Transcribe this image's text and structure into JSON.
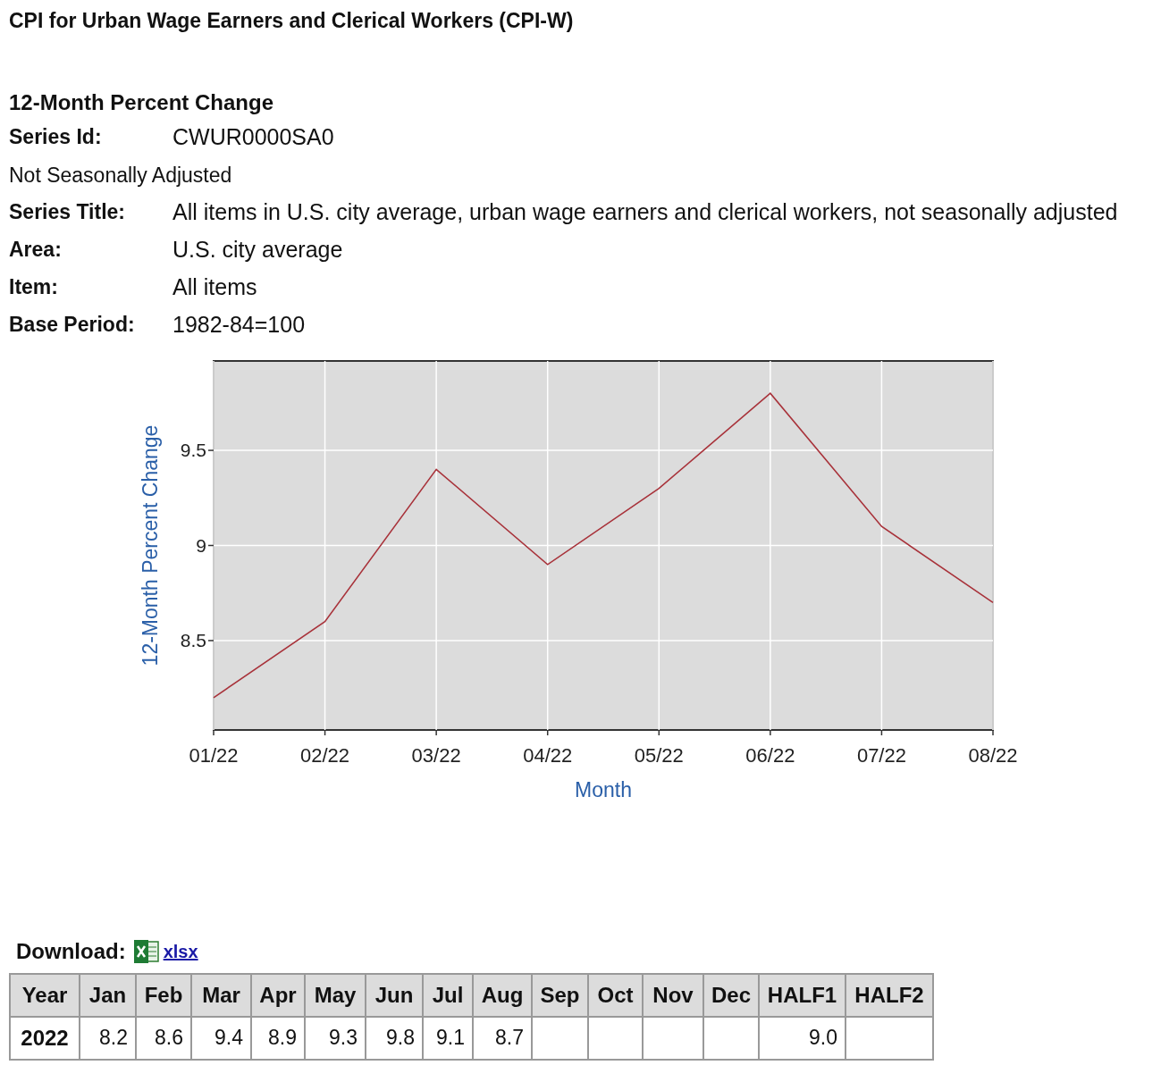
{
  "title": "CPI for Urban Wage Earners and Clerical Workers (CPI-W)",
  "heading": "12-Month Percent Change",
  "details": [
    {
      "label": "Series Id:",
      "value": "CWUR0000SA0"
    },
    {
      "note": "Not Seasonally Adjusted"
    },
    {
      "label": "Series Title:",
      "value": "All items in U.S. city average, urban wage earners and clerical workers, not seasonally adjusted"
    },
    {
      "label": "Area:",
      "value": "U.S. city average"
    },
    {
      "label": "Item:",
      "value": "All items"
    },
    {
      "label": "Base Period:",
      "value": "1982-84=100"
    }
  ],
  "chart": {
    "chart_data": {
      "type": "line",
      "xlabel": "Month",
      "ylabel": "12-Month Percent Change",
      "categories": [
        "01/22",
        "02/22",
        "03/22",
        "04/22",
        "05/22",
        "06/22",
        "07/22",
        "08/22"
      ],
      "series": [
        {
          "color": "#a8323a",
          "values": [
            8.2,
            8.6,
            9.4,
            8.9,
            9.3,
            9.8,
            9.1,
            8.7
          ]
        }
      ],
      "ylim": [
        8.03,
        9.97
      ],
      "grid": true,
      "yticks": [
        8.5,
        {
          "value": 9,
          "label": "9"
        },
        9.5
      ]
    }
  },
  "download": {
    "label": "Download:",
    "link": "xlsx"
  },
  "table": {
    "columns": [
      "Year",
      "Jan",
      "Feb",
      "Mar",
      "Apr",
      "May",
      "Jun",
      "Jul",
      "Aug",
      "Sep",
      "Oct",
      "Nov",
      "Dec",
      "HALF1",
      "HALF2"
    ],
    "rows": [
      {
        "cells": [
          "2022",
          "8.2",
          "8.6",
          "9.4",
          "8.9",
          "9.3",
          "9.8",
          "9.1",
          "8.7",
          "",
          "",
          "",
          "",
          "9.0",
          ""
        ]
      }
    ]
  }
}
